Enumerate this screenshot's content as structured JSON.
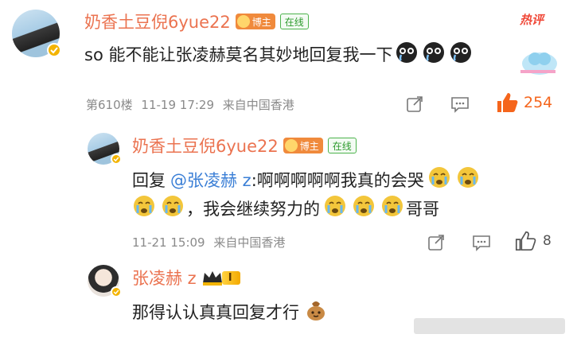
{
  "top_comment": {
    "username": "奶香土豆倪6yue22",
    "blogger_tag": "博主",
    "online_tag": "在线",
    "hot_label": "热评",
    "text": "so 能不能让张凌赫莫名其妙地回复我一下",
    "floor": "第610楼",
    "datetime": "11-19 17:29",
    "source": "来自中国香港",
    "likes": "254"
  },
  "reply_1": {
    "username": "奶香土豆倪6yue22",
    "blogger_tag": "博主",
    "online_tag": "在线",
    "reply_prefix": "回复",
    "mention": "@张凌赫 z",
    "text_line1": ":啊啊啊啊啊我真的会哭",
    "text_line2": "，我会继续努力的",
    "text_line2_end": "哥哥",
    "datetime": "11-21 15:09",
    "source": "来自中国香港",
    "likes": "8"
  },
  "reply_2": {
    "username": "张凌赫 z",
    "level_tag": "I",
    "text": "那得认认真真回复才行"
  },
  "colors": {
    "username": "#eb7350",
    "mention": "#3b7fd6",
    "like_active": "#f5651c",
    "hot": "#f04a3a"
  }
}
